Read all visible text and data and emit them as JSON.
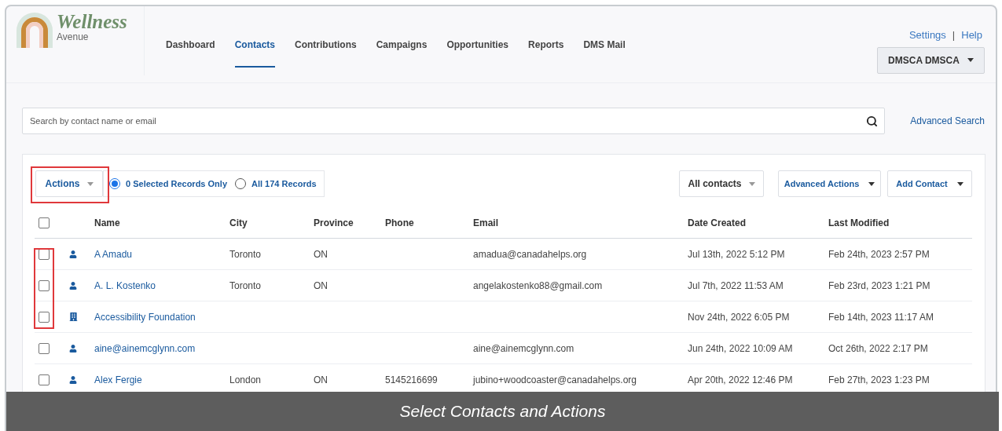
{
  "logo": {
    "title": "Wellness",
    "subtitle": "Avenue"
  },
  "nav": [
    {
      "label": "Dashboard",
      "selected": false
    },
    {
      "label": "Contacts",
      "selected": true
    },
    {
      "label": "Contributions",
      "selected": false
    },
    {
      "label": "Campaigns",
      "selected": false
    },
    {
      "label": "Opportunities",
      "selected": false
    },
    {
      "label": "Reports",
      "selected": false
    },
    {
      "label": "DMS Mail",
      "selected": false
    }
  ],
  "top_links": {
    "settings": "Settings",
    "separator": "|",
    "help": "Help"
  },
  "user_menu": "DMSCA DMSCA",
  "search": {
    "placeholder": "Search by contact name or email",
    "advanced_link": "Advanced Search"
  },
  "toolbar": {
    "actions": "Actions",
    "scope": [
      {
        "label": "0 Selected Records Only",
        "selected": true
      },
      {
        "label": "All 174 Records",
        "selected": false
      }
    ],
    "filter": "All contacts",
    "advanced_actions": "Advanced Actions",
    "add_contact": "Add Contact"
  },
  "table": {
    "header_checked": false,
    "columns": [
      "Name",
      "City",
      "Province",
      "Phone",
      "Email",
      "Date Created",
      "Last Modified"
    ],
    "rows": [
      {
        "kind": "person",
        "checked": false,
        "name": "A Amadu",
        "city": "Toronto",
        "province": "ON",
        "phone": "",
        "email": "amadua@canadahelps.org",
        "created": "Jul 13th, 2022 5:12 PM",
        "modified": "Feb 24th, 2023 2:57 PM"
      },
      {
        "kind": "person",
        "checked": false,
        "name": "A. L. Kostenko",
        "city": "Toronto",
        "province": "ON",
        "phone": "",
        "email": "angelakostenko88@gmail.com",
        "created": "Jul 7th, 2022 11:53 AM",
        "modified": "Feb 23rd, 2023 1:21 PM"
      },
      {
        "kind": "organization",
        "checked": false,
        "name": "Accessibility Foundation",
        "city": "",
        "province": "",
        "phone": "",
        "email": "",
        "created": "Nov 24th, 2022 6:05 PM",
        "modified": "Feb 14th, 2023 11:17 AM"
      },
      {
        "kind": "person",
        "checked": false,
        "name": "aine@ainemcglynn.com",
        "city": "",
        "province": "",
        "phone": "",
        "email": "aine@ainemcglynn.com",
        "created": "Jun 24th, 2022 10:09 AM",
        "modified": "Oct 26th, 2022 2:17 PM"
      },
      {
        "kind": "person",
        "checked": false,
        "name": "Alex Fergie",
        "city": "London",
        "province": "ON",
        "phone": "5145216699",
        "email": "jubino+woodcoaster@canadahelps.org",
        "created": "Apr 20th, 2022 12:46 PM",
        "modified": "Feb 27th, 2023 1:23 PM"
      }
    ]
  },
  "caption": "Select Contacts and Actions"
}
